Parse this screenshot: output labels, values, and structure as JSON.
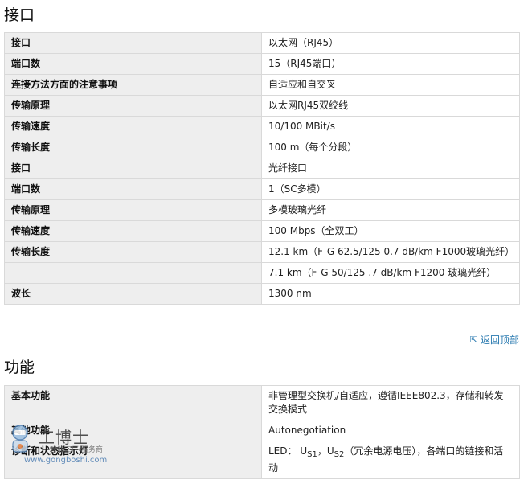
{
  "sections": {
    "interface": {
      "title": "接口",
      "rows": [
        {
          "key": "接口",
          "value": "以太网（RJ45）"
        },
        {
          "key": "端口数",
          "value": "15（RJ45端口）"
        },
        {
          "key": "连接方法方面的注意事项",
          "value": "自适应和自交叉"
        },
        {
          "key": "传输原理",
          "value": "以太网RJ45双绞线"
        },
        {
          "key": "传输速度",
          "value": "10/100 MBit/s"
        },
        {
          "key": "传输长度",
          "value": "100 m（每个分段）"
        },
        {
          "key": "接口",
          "value": "光纤接口"
        },
        {
          "key": "端口数",
          "value": "1（SC多模）"
        },
        {
          "key": "传输原理",
          "value": "多模玻璃光纤"
        },
        {
          "key": "传输速度",
          "value": "100 Mbps（全双工）"
        },
        {
          "key": "传输长度",
          "value": "12.1 km（F-G 62.5/125 0.7 dB/km F1000玻璃光纤）"
        },
        {
          "key": "",
          "value": "7.1 km（F-G 50/125 .7 dB/km F1200 玻璃光纤）"
        },
        {
          "key": "波长",
          "value": "1300 nm"
        }
      ]
    },
    "function": {
      "title": "功能",
      "rows": [
        {
          "key": "基本功能",
          "value": "非管理型交换机/自适应，遵循IEEE802.3，存储和转发交换模式"
        },
        {
          "key": "其他功能",
          "value": "Autonegotiation"
        },
        {
          "key": "诊断和状态指示灯",
          "led_prefix": "LED：",
          "us": "U",
          "sub1": "S1",
          "sep": "，",
          "sub2": "S2",
          "led_suffix": "（冗余电源电压），各端口的链接和活动"
        }
      ]
    }
  },
  "back_to_top": "返回顶部",
  "watermark": {
    "brand": "工博士",
    "subtitle": "智能工厂 服务商",
    "site": "www.gongboshi.com"
  }
}
